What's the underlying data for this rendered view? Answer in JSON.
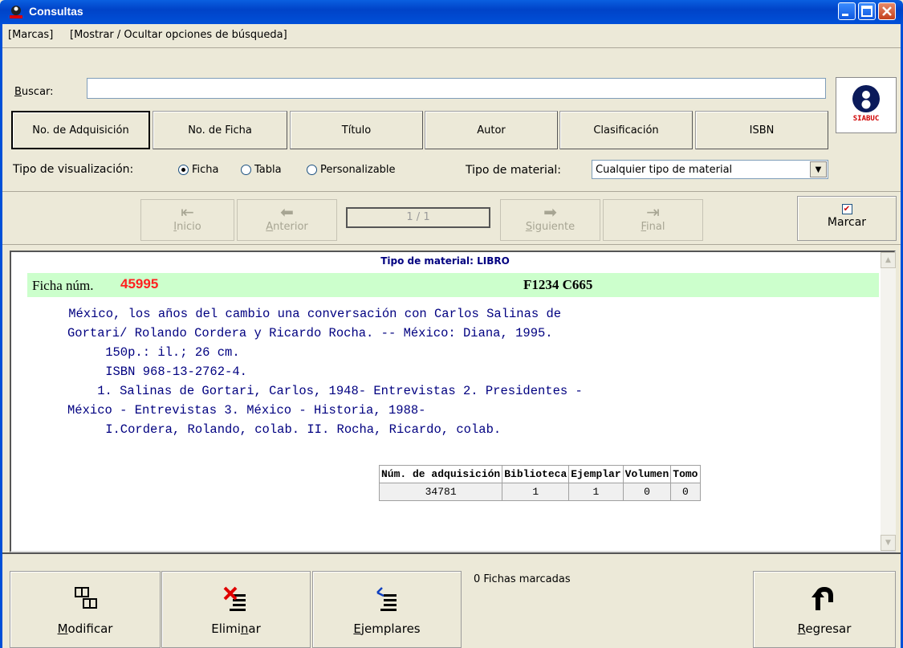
{
  "window": {
    "title": "Consultas"
  },
  "menu": {
    "items": [
      "[Marcas]",
      "[Mostrar / Ocultar opciones de búsqueda]"
    ]
  },
  "search": {
    "label_prefix": "B",
    "label_rest": "uscar:",
    "value": "",
    "logo_text": "SIABUC"
  },
  "fields": [
    "No. de Adquisición",
    "No. de Ficha",
    "Título",
    "Autor",
    "Clasificación",
    "ISBN"
  ],
  "visualization": {
    "label": "Tipo de visualización:",
    "options": [
      "Ficha",
      "Tabla",
      "Personalizable"
    ],
    "selected": "Ficha"
  },
  "material": {
    "label": "Tipo de material:",
    "value": "Cualquier tipo de material"
  },
  "nav": {
    "first": {
      "pre": "",
      "u": "I",
      "post": "nicio"
    },
    "prev": {
      "pre": "",
      "u": "A",
      "post": "nterior"
    },
    "next": {
      "pre": "",
      "u": "S",
      "post": "iguiente"
    },
    "last": {
      "pre": "",
      "u": "F",
      "post": "inal"
    },
    "pager": "1 / 1",
    "mark": "Marcar",
    "mark_checked": true
  },
  "record": {
    "tipo_material": "Tipo de material: LIBRO",
    "ficha_label": "Ficha núm.",
    "ficha_num": "45995",
    "clasificacion": "F1234 C665",
    "lines": [
      "    México, los años del cambio una conversación con Carlos Salinas de",
      "Gortari/ Rolando Cordera y Ricardo Rocha. -- México: Diana, 1995.",
      "    150p.: il.; 26 cm.",
      "    ISBN 968-13-2762-4.",
      "    1. Salinas de Gortari, Carlos, 1948- Entrevistas 2. Presidentes -",
      "México - Entrevistas 3. México - Historia, 1988-",
      "    I.Cordera, Rolando, colab. II. Rocha, Ricardo, colab."
    ],
    "holdings": {
      "headers": [
        "Núm. de adquisición",
        "Biblioteca",
        "Ejemplar",
        "Volumen",
        "Tomo"
      ],
      "rows": [
        [
          "34781",
          "1",
          "1",
          "0",
          "0"
        ]
      ]
    }
  },
  "bottom": {
    "modificar": {
      "u": "M",
      "post": "odificar"
    },
    "eliminar": {
      "pre": "Elimi",
      "u": "n",
      "post": "ar"
    },
    "ejemplares": {
      "u": "E",
      "post": "jemplares"
    },
    "regresar": {
      "u": "R",
      "post": "egresar"
    },
    "marked": "0 Fichas marcadas"
  },
  "colors": {
    "titlebar": "#0050d8",
    "ficha_bar": "#ccffcc",
    "record_text": "#000080",
    "ficha_num": "#ff2020"
  }
}
